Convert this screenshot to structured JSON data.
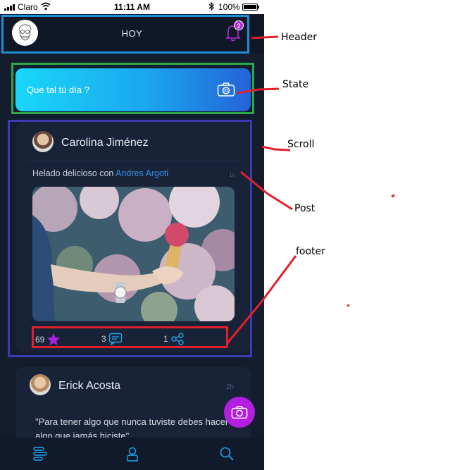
{
  "status_bar": {
    "carrier": "Claro",
    "time": "11:11 AM",
    "battery": "100%"
  },
  "header": {
    "title": "HOY",
    "notification_count": "2"
  },
  "state": {
    "prompt": "Que tal tú día ?"
  },
  "posts": [
    {
      "author": "Carolina Jiménez",
      "caption_text": "Helado delicioso con ",
      "caption_mention": "Andres Argoti",
      "time": "1h",
      "likes": "69",
      "comments": "3",
      "shares": "1"
    },
    {
      "author": "Erick Acosta",
      "time": "2h",
      "quote": "\"Para tener algo que nunca tuviste debes hacer algo que jamás hiciste\""
    }
  ],
  "annotations": {
    "header": "Header",
    "state": "State",
    "scroll": "Scroll",
    "post": "Post",
    "footer": "footer"
  },
  "icons": {
    "bell": "bell-icon",
    "camera": "camera-icon",
    "star": "star-icon",
    "comment": "comment-icon",
    "share": "share-icon",
    "feed": "feed-icon",
    "profile": "profile-icon",
    "search": "search-icon"
  },
  "colors": {
    "background": "#141d2e",
    "card": "#182338",
    "accent_purple": "#b31fe0",
    "accent_blue": "#1aa7ee",
    "annotation_red": "#e0202a",
    "annotation_blue": "#1e8fd6",
    "annotation_green": "#2aa84a",
    "annotation_indigo": "#3b3bb5"
  }
}
